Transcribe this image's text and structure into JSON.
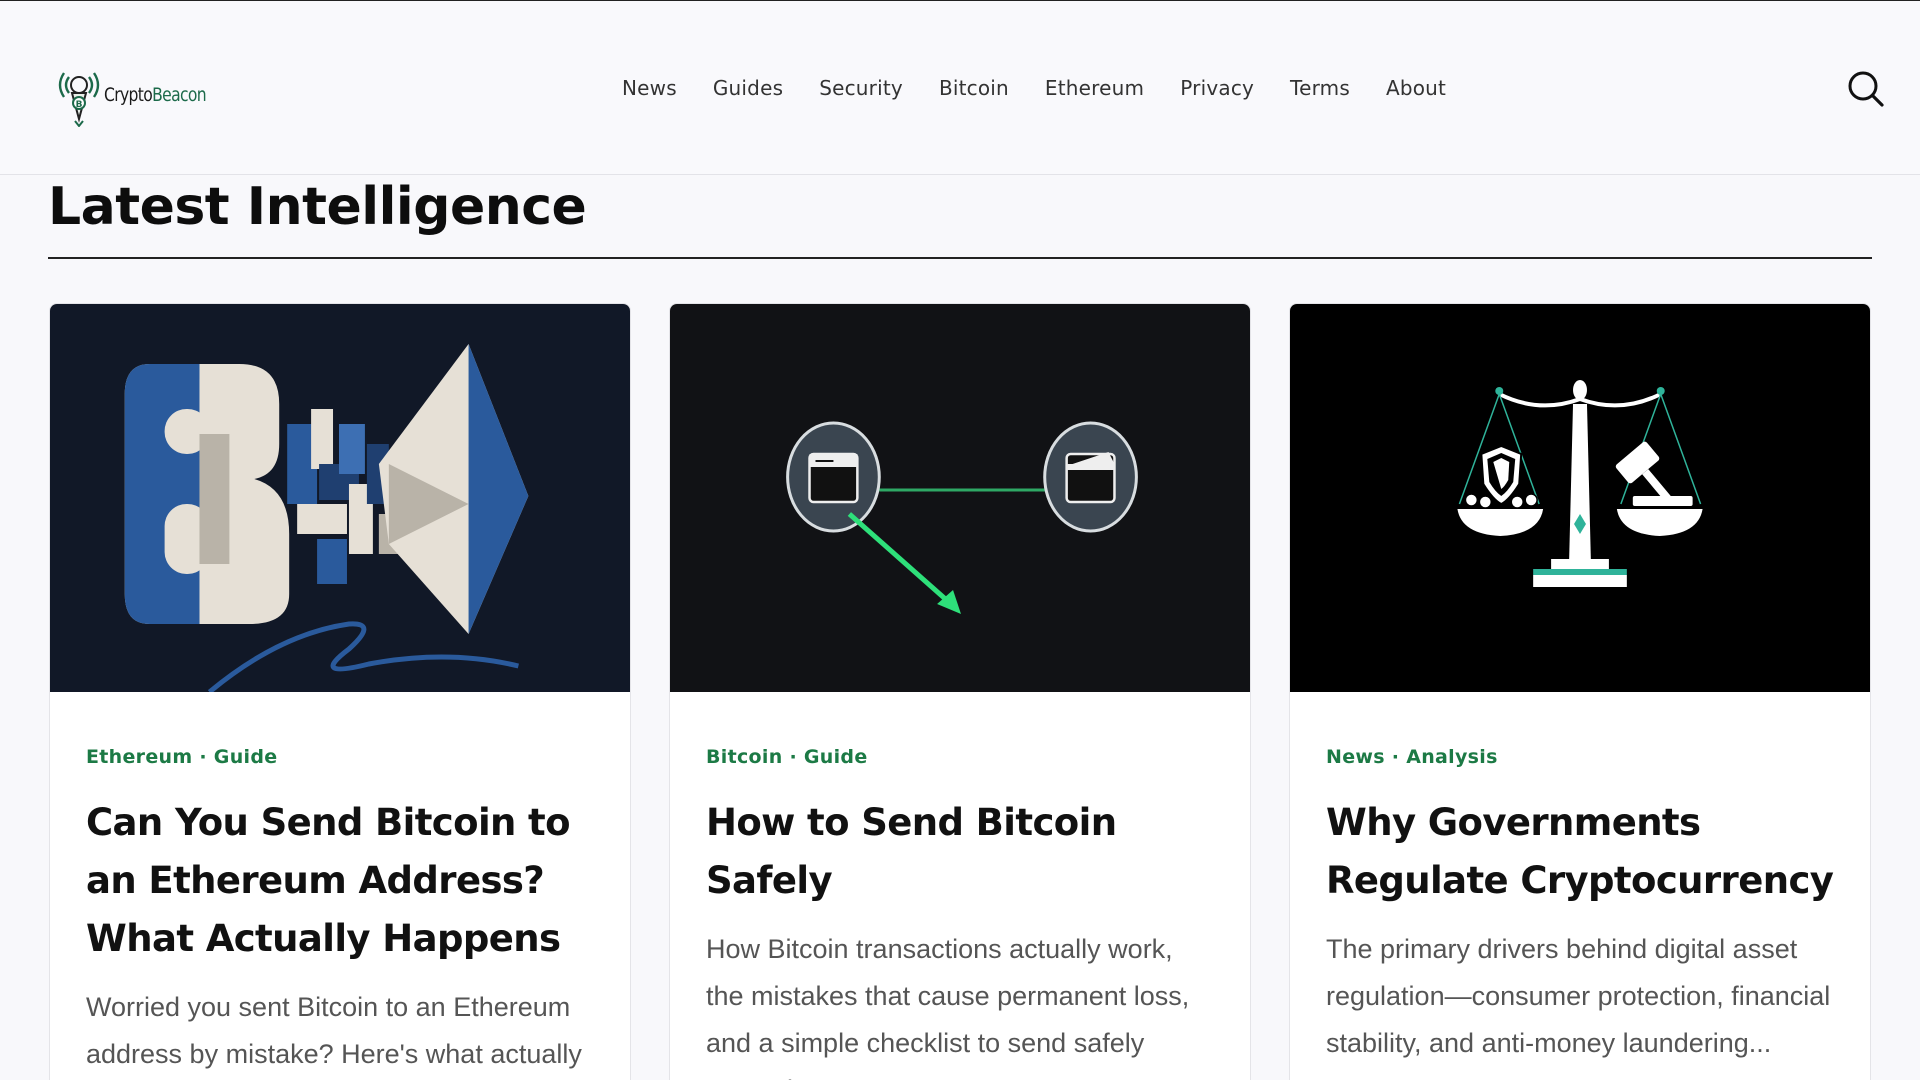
{
  "brand": {
    "name_part1": "Crypto",
    "name_part2": "Beacon",
    "logo_icon": "beacon-bitcoin-icon"
  },
  "nav": {
    "items": [
      "News",
      "Guides",
      "Security",
      "Bitcoin",
      "Ethereum",
      "Privacy",
      "Terms",
      "About"
    ]
  },
  "search": {
    "icon": "search-icon"
  },
  "section": {
    "title": "Latest Intelligence"
  },
  "cards": [
    {
      "tag": "Ethereum · Guide",
      "title": "Can You Send Bitcoin to an Ethereum Address? What Actually Happens",
      "excerpt": "Worried you sent Bitcoin to an Ethereum address by mistake? Here's what actually",
      "image_icon": "bitcoin-ethereum-merge-illustration"
    },
    {
      "tag": "Bitcoin · Guide",
      "title": "How to Send Bitcoin Safely",
      "excerpt": "How Bitcoin transactions actually work, the mistakes that cause permanent loss, and a simple checklist to send safely every time.",
      "image_icon": "wallet-transfer-illustration"
    },
    {
      "tag": "News · Analysis",
      "title": "Why Governments Regulate Cryptocurrency",
      "excerpt": "The primary drivers behind digital asset regulation—consumer protection, financial stability, and anti-money laundering...",
      "image_icon": "scales-of-justice-illustration"
    }
  ],
  "colors": {
    "accent_green": "#1c7a45",
    "neon_green": "#2ee07a",
    "eth_blue": "#2a5a9c"
  }
}
